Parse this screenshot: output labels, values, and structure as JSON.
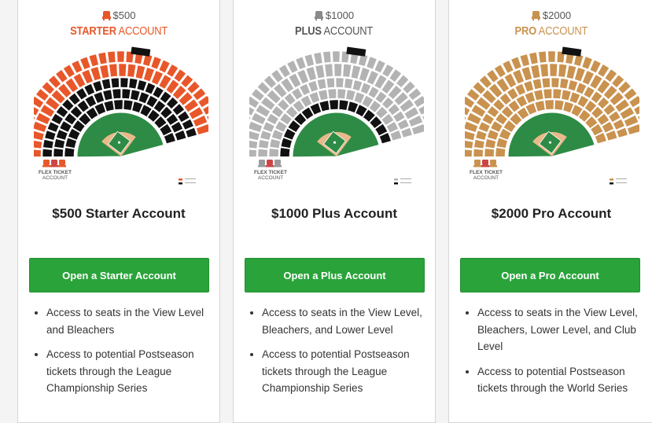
{
  "plans": [
    {
      "price_badge": "$500",
      "tier_bold": "STARTER",
      "tier_light": "ACCOUNT",
      "color": "#e8572a",
      "map_flex_label_1": "FLEX TICKET",
      "map_flex_label_2": "ACCOUNT",
      "title": "$500 Starter Account",
      "button_label": "Open a Starter Account",
      "features": [
        "Access to seats in the View Level and Bleachers",
        "Access to potential Postseason tickets through the League Championship Series"
      ]
    },
    {
      "price_badge": "$1000",
      "tier_bold": "PLUS",
      "tier_light": "ACCOUNT",
      "color": "#b3b3b3",
      "map_flex_label_1": "FLEX TICKET",
      "map_flex_label_2": "ACCOUNT",
      "title": "$1000 Plus Account",
      "button_label": "Open a Plus Account",
      "features": [
        "Access to seats in the View Level, Bleachers, and Lower Level",
        "Access to potential Postseason tickets through the League Championship Series"
      ]
    },
    {
      "price_badge": "$2000",
      "tier_bold": "PRO",
      "tier_light": "ACCOUNT",
      "color": "#c9924f",
      "map_flex_label_1": "FLEX TICKET",
      "map_flex_label_2": "ACCOUNT",
      "title": "$2000 Pro Account",
      "button_label": "Open a Pro Account",
      "features": [
        "Access to seats in the View Level, Bleachers, Lower Level, and Club Level",
        "Access to potential Postseason tickets through the World Series"
      ]
    }
  ],
  "colors": {
    "button_green": "#2aa33a",
    "field_green": "#2e8b45",
    "infield_dirt": "#e9b98a",
    "unavailable": "#111111"
  }
}
